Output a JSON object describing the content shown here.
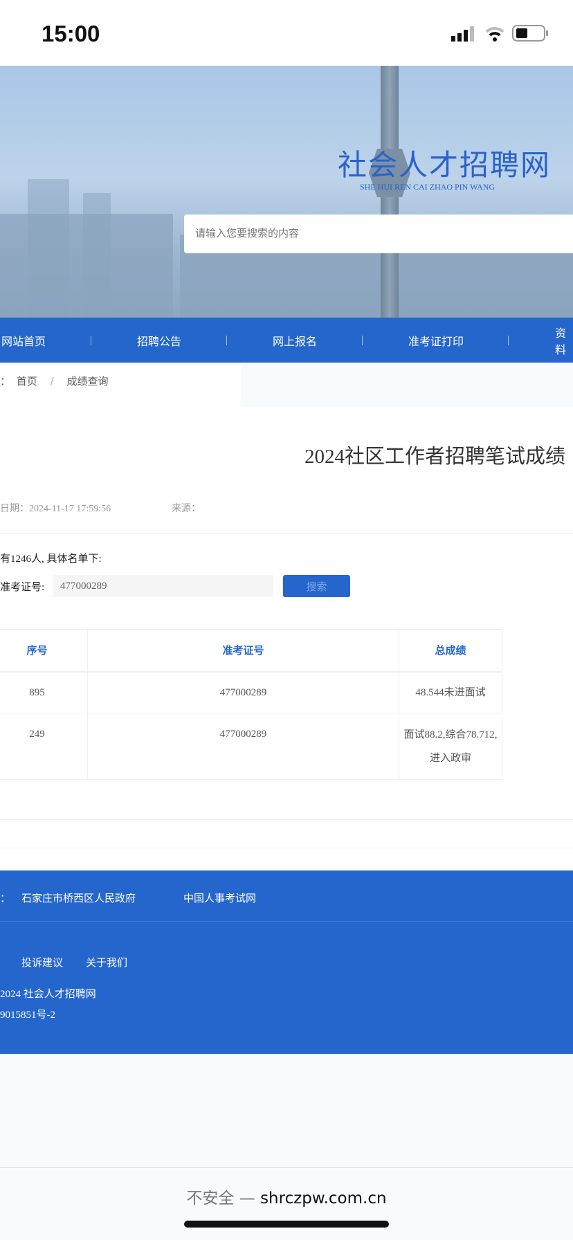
{
  "status_bar": {
    "time": "15:00"
  },
  "header": {
    "site_title": "社会人才招聘网",
    "site_subtitle": "SHE HUI REN CAI ZHAO PIN WANG",
    "search_placeholder": "请输入您要搜索的内容"
  },
  "nav": {
    "items": [
      "网站首页",
      "招聘公告",
      "网上报名",
      "准考证打印",
      "资料"
    ]
  },
  "breadcrumb": {
    "prefix": "：",
    "home": "首页",
    "sep": "/",
    "current": "成绩查询"
  },
  "article": {
    "title": "2024社区工作者招聘笔试成绩",
    "date_label": "日期：",
    "date": "2024-11-17 17:59:56",
    "source_label": "来源：",
    "summary": "有1246人, 具体名单下:",
    "query_label": "准考证号:",
    "query_value": "477000289",
    "search_button": "搜索"
  },
  "table": {
    "headers": [
      "序号",
      "准考证号",
      "总成绩"
    ],
    "rows": [
      [
        "895",
        "477000289",
        "48.544未进面试"
      ],
      [
        "249",
        "477000289",
        "面试88.2,综合78.712,进入政审"
      ]
    ]
  },
  "footer": {
    "links_prefix": "：",
    "links": [
      "石家庄市桥西区人民政府",
      "中国人事考试网"
    ],
    "bottom_links": [
      "投诉建议",
      "关于我们"
    ],
    "copyright": "2024 社会人才招聘网",
    "icp": "9015851号-2"
  },
  "browser": {
    "insecure": "不安全 — ",
    "url": "shrczpw.com.cn"
  }
}
